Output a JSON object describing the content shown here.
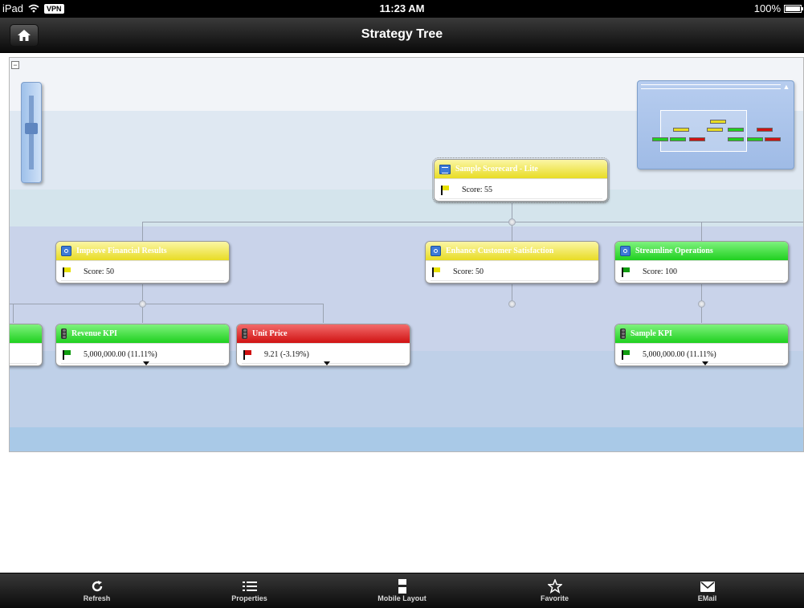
{
  "status_bar": {
    "device": "iPad",
    "vpn_badge": "VPN",
    "time": "11:23 AM",
    "battery": "100%",
    "battery_level": 1.0
  },
  "nav_bar": {
    "title": "Strategy Tree",
    "home_icon": "home-icon"
  },
  "colors": {
    "yellow": "#e8dc24",
    "green": "#1fd01f",
    "red": "#d01212",
    "band_blue": "#c5d1ea"
  },
  "tree": {
    "root": {
      "title": "Sample Scorecard - Lite",
      "value": "Score: 55",
      "status": "yellow"
    },
    "objectives": [
      {
        "title": "Improve Financial Results",
        "value": "Score: 50",
        "status": "yellow"
      },
      {
        "title": "Enhance Customer Satisfaction",
        "value": "Score: 50",
        "status": "yellow"
      },
      {
        "title": "Streamline Operations",
        "value": "Score: 100",
        "status": "green"
      }
    ],
    "kpis": [
      {
        "title": "Revenue KPI",
        "value": "5,000,000.00 (11.11%)",
        "status": "green"
      },
      {
        "title": "Unit Price",
        "value": "9.21 (-3.19%)",
        "status": "red"
      },
      {
        "title": "Sample KPI",
        "value": "5,000,000.00 (11.11%)",
        "status": "green"
      }
    ]
  },
  "toolbar": {
    "items": [
      {
        "label": "Refresh",
        "icon": "refresh-icon"
      },
      {
        "label": "Properties",
        "icon": "list-icon"
      },
      {
        "label": "Mobile Layout",
        "icon": "layout-icon"
      },
      {
        "label": "Favorite",
        "icon": "star-icon"
      },
      {
        "label": "EMail",
        "icon": "mail-icon"
      }
    ]
  }
}
